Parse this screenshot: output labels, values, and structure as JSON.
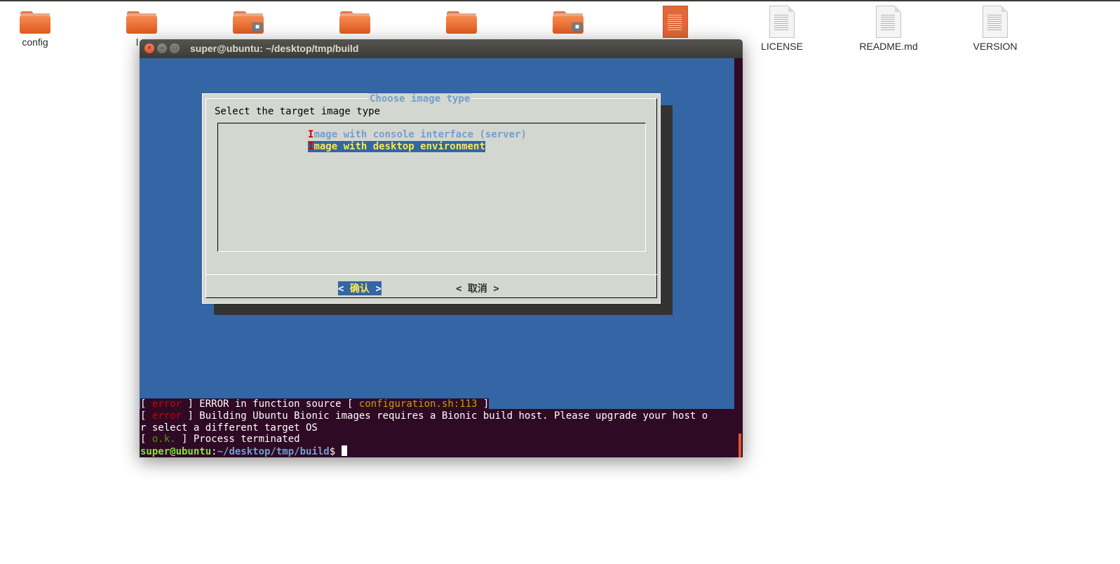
{
  "desktop": {
    "icons": [
      {
        "label": "config",
        "type": "folder"
      },
      {
        "label": "l",
        "type": "folder"
      },
      {
        "label": "",
        "type": "folder-locked"
      },
      {
        "label": "",
        "type": "folder"
      },
      {
        "label": "",
        "type": "folder"
      },
      {
        "label": "",
        "type": "folder-locked"
      },
      {
        "label": "",
        "type": "document-orange"
      },
      {
        "label": "LICENSE",
        "type": "document"
      },
      {
        "label": "README.md",
        "type": "document"
      },
      {
        "label": "VERSION",
        "type": "document"
      }
    ]
  },
  "window": {
    "title": "super@ubuntu: ~/desktop/tmp/build",
    "close_glyph": "×",
    "min_glyph": "–",
    "max_glyph": "□"
  },
  "dialog": {
    "title": "Choose image type",
    "prompt": "Select the target image type",
    "options": [
      {
        "hotkey": "I",
        "rest": "mage with console interface (server)"
      },
      {
        "hotkey": "I",
        "rest": "mage with desktop environment"
      }
    ],
    "ok_label": "确认",
    "cancel_label": "取消",
    "btn_left": "<",
    "btn_right": ">"
  },
  "terminal": {
    "line1": {
      "open": "[ ",
      "tag": "error",
      "mid": " ] ERROR in function source [ ",
      "file": "configuration.sh:113",
      "close": " ]"
    },
    "line2": {
      "open": "[ ",
      "tag": "error",
      "text": " ] Building Ubuntu Bionic images requires a Bionic build host. Please upgrade your host o"
    },
    "line3": {
      "text": "r select a different target OS"
    },
    "line4": {
      "open": "[ ",
      "tag": "o.k.",
      "text": " ] Process terminated"
    },
    "prompt": {
      "user": "super@ubuntu",
      "colon": ":",
      "path": "~/desktop/tmp/build",
      "dollar": "$ "
    }
  },
  "colors": {
    "terminal_bg": "#2f0a24",
    "dialog_bg": "#d3d7cf",
    "screen_blue": "#3465a4",
    "accent_orange": "#e2542e"
  }
}
